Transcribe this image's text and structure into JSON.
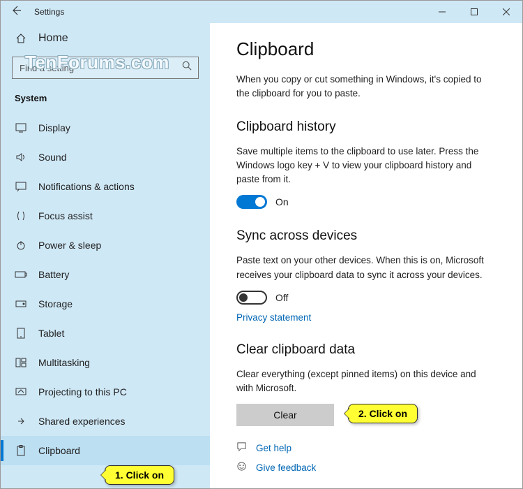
{
  "titlebar": {
    "title": "Settings"
  },
  "sidebar": {
    "home": "Home",
    "search_placeholder": "Find a setting",
    "section": "System",
    "items": [
      {
        "label": "Display"
      },
      {
        "label": "Sound"
      },
      {
        "label": "Notifications & actions"
      },
      {
        "label": "Focus assist"
      },
      {
        "label": "Power & sleep"
      },
      {
        "label": "Battery"
      },
      {
        "label": "Storage"
      },
      {
        "label": "Tablet"
      },
      {
        "label": "Multitasking"
      },
      {
        "label": "Projecting to this PC"
      },
      {
        "label": "Shared experiences"
      },
      {
        "label": "Clipboard"
      }
    ]
  },
  "content": {
    "title": "Clipboard",
    "intro": "When you copy or cut something in Windows, it's copied to the clipboard for you to paste.",
    "history": {
      "heading": "Clipboard history",
      "desc": "Save multiple items to the clipboard to use later. Press the Windows logo key + V to view your clipboard history and paste from it.",
      "state": "On"
    },
    "sync": {
      "heading": "Sync across devices",
      "desc": "Paste text on your other devices. When this is on, Microsoft receives your clipboard data to sync it across your devices.",
      "state": "Off",
      "privacy": "Privacy statement"
    },
    "clear": {
      "heading": "Clear clipboard data",
      "desc": "Clear everything (except pinned items) on this device and with Microsoft.",
      "button": "Clear"
    },
    "footer": {
      "help": "Get help",
      "feedback": "Give feedback"
    }
  },
  "annotations": {
    "callout1": "1. Click on",
    "callout2": "2. Click on"
  },
  "watermark": "TenForums.com"
}
